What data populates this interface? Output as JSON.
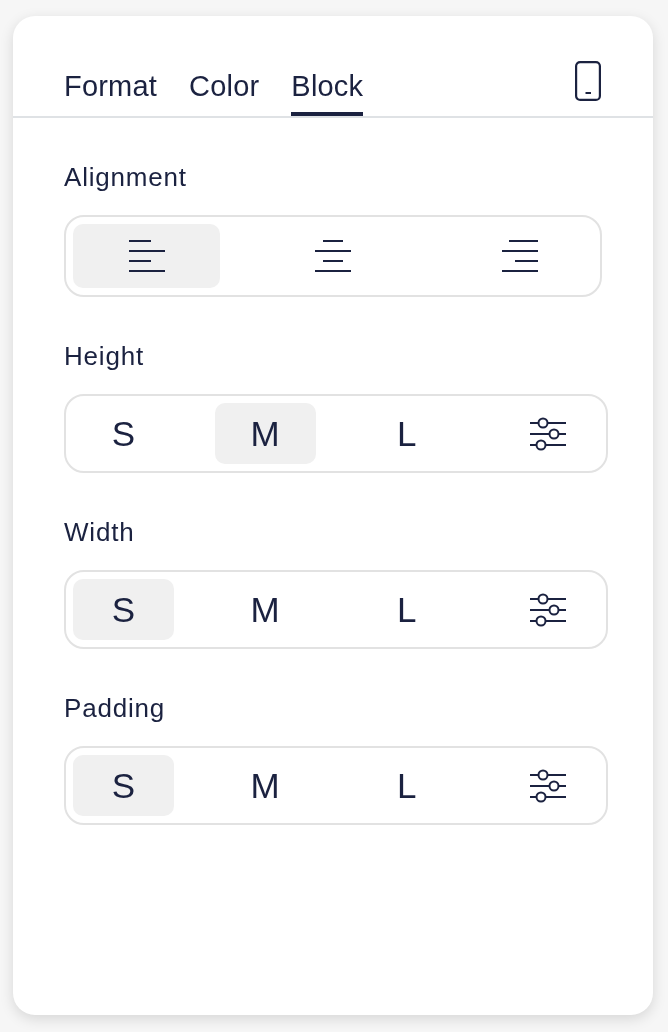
{
  "tabs": [
    {
      "label": "Format",
      "selected": false
    },
    {
      "label": "Color",
      "selected": false
    },
    {
      "label": "Block",
      "selected": true
    }
  ],
  "sections": [
    {
      "label": "Alignment",
      "kind": "alignment",
      "options": [
        {
          "kind": "left",
          "selected": true
        },
        {
          "kind": "center",
          "selected": false
        },
        {
          "kind": "right",
          "selected": false
        }
      ]
    },
    {
      "label": "Height",
      "kind": "size",
      "options": [
        {
          "kind": "text",
          "label": "S",
          "selected": false
        },
        {
          "kind": "text",
          "label": "M",
          "selected": true
        },
        {
          "kind": "text",
          "label": "L",
          "selected": false
        },
        {
          "kind": "custom",
          "selected": false
        }
      ]
    },
    {
      "label": "Width",
      "kind": "size",
      "options": [
        {
          "kind": "text",
          "label": "S",
          "selected": true
        },
        {
          "kind": "text",
          "label": "M",
          "selected": false
        },
        {
          "kind": "text",
          "label": "L",
          "selected": false
        },
        {
          "kind": "custom",
          "selected": false
        }
      ]
    },
    {
      "label": "Padding",
      "kind": "size",
      "options": [
        {
          "kind": "text",
          "label": "S",
          "selected": true
        },
        {
          "kind": "text",
          "label": "M",
          "selected": false
        },
        {
          "kind": "text",
          "label": "L",
          "selected": false
        },
        {
          "kind": "custom",
          "selected": false
        }
      ]
    }
  ]
}
